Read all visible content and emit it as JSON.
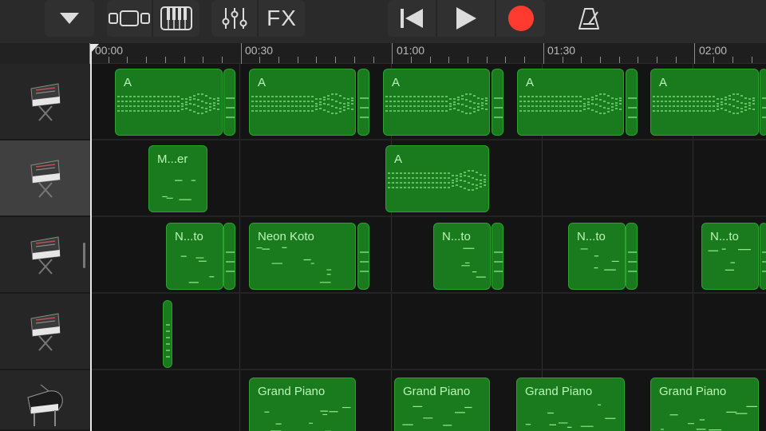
{
  "toolbar": {
    "buttons": [
      {
        "name": "browser-toggle-button",
        "icon": "triangle-down-icon"
      },
      {
        "name": "tracks-view-button",
        "icon": "tracks-view-icon"
      },
      {
        "name": "keyboard-button",
        "icon": "piano-keys-icon"
      },
      {
        "name": "mixer-button",
        "icon": "sliders-icon"
      },
      {
        "name": "fx-button",
        "label": "FX"
      },
      {
        "name": "rewind-button",
        "icon": "skip-back-icon"
      },
      {
        "name": "play-button",
        "icon": "play-icon"
      },
      {
        "name": "record-button",
        "icon": "record-icon"
      },
      {
        "name": "metronome-button",
        "icon": "metronome-icon"
      }
    ],
    "fx_label": "FX",
    "record_color": "#ff3b30"
  },
  "ruler": {
    "labels": [
      "00:00",
      "00:30",
      "01:00",
      "01:30",
      "02:00"
    ]
  },
  "tracks": [
    {
      "instrument": "synth-keyboard",
      "selected": false
    },
    {
      "instrument": "synth-keyboard",
      "selected": true
    },
    {
      "instrument": "synth-keyboard",
      "selected": false
    },
    {
      "instrument": "synth-keyboard",
      "selected": false
    },
    {
      "instrument": "grand-piano",
      "selected": false
    }
  ],
  "regions": {
    "track1": [
      "A",
      "A",
      "A",
      "A",
      "A"
    ],
    "track2": [
      "M...er",
      "A"
    ],
    "track3": [
      "N...to",
      "Neon Koto",
      "N...to",
      "N...to",
      "N...to"
    ],
    "track4": [
      ""
    ],
    "track5": [
      "Grand Piano",
      "Grand Piano",
      "Grand Piano",
      "Grand Piano"
    ]
  },
  "colors": {
    "region_fill": "#1a7a1e",
    "region_border": "#2aa32f",
    "region_text": "#b9f7b5",
    "background": "#141414"
  }
}
